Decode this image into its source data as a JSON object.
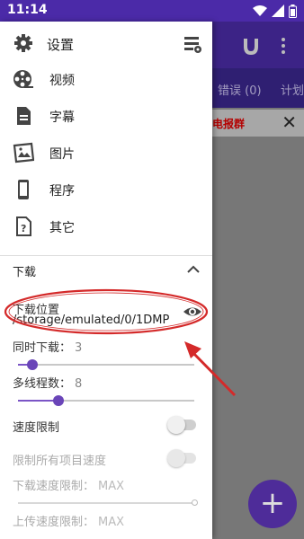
{
  "status_bar": {
    "time": "11:14",
    "icons": [
      "wifi-icon",
      "signal-icon",
      "battery-icon"
    ]
  },
  "background_app": {
    "tabs": [
      "错误 (0)",
      "计划"
    ],
    "banner_text": "电报群",
    "fab_label": "+"
  },
  "drawer": {
    "menu": [
      {
        "label": "设置",
        "icon": "gear-icon"
      },
      {
        "label": "视频",
        "icon": "film-reel-icon"
      },
      {
        "label": "字幕",
        "icon": "subtitle-file-icon"
      },
      {
        "label": "图片",
        "icon": "picture-icon"
      },
      {
        "label": "程序",
        "icon": "phone-icon"
      },
      {
        "label": "其它",
        "icon": "question-file-icon"
      }
    ],
    "download": {
      "section_title": "下载",
      "location_label": "下载位置",
      "location_value": "/storage/emulated/0/1DMP",
      "concurrent_label": "同时下载：",
      "concurrent_value": "3",
      "concurrent_fraction": 0.08,
      "threads_label": "多线程数：",
      "threads_value": "8",
      "threads_fraction": 0.23,
      "speed_limit_label": "速度限制",
      "speed_limit_enabled": false,
      "limit_all_label": "限制所有项目速度",
      "limit_all_enabled": false,
      "download_limit_label": "下载速度限制：",
      "download_limit_value": "MAX",
      "download_limit_fraction": 1.0,
      "upload_limit_label": "上传速度限制：",
      "upload_limit_value": "MAX"
    }
  },
  "colors": {
    "primary": "#4b2aa8",
    "accent": "#7b55c6",
    "annotation": "#d42a2a"
  }
}
